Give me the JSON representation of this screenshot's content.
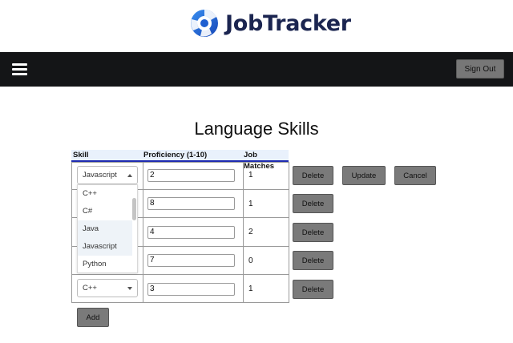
{
  "app": {
    "name": "JobTracker"
  },
  "nav": {
    "sign_out_label": "Sign Out"
  },
  "page": {
    "title": "Language Skills"
  },
  "table": {
    "headers": {
      "skill": "Skill",
      "proficiency": "Proficiency (1-10)",
      "job_matches": "Job Matches"
    },
    "rows": [
      {
        "skill": "Javascript",
        "proficiency": "2",
        "job_matches": "1"
      },
      {
        "skill": "",
        "proficiency": "8",
        "job_matches": "1"
      },
      {
        "skill": "",
        "proficiency": "4",
        "job_matches": "2"
      },
      {
        "skill": "",
        "proficiency": "7",
        "job_matches": "0"
      },
      {
        "skill": "C++",
        "proficiency": "3",
        "job_matches": "1"
      }
    ]
  },
  "buttons": {
    "delete": "Delete",
    "update": "Update",
    "cancel": "Cancel",
    "add": "Add"
  },
  "dropdown": {
    "options": [
      "C++",
      "C#",
      "Java",
      "Javascript",
      "Python"
    ],
    "highlighted": [
      "Java",
      "Javascript"
    ]
  },
  "colors": {
    "navbar": "#141517",
    "button": "#7a7a7a",
    "header_bg": "#e9f1fc",
    "header_underline": "#1e2bb0",
    "logo_text": "#1b2550",
    "logo_mark": "#1f6fd6"
  }
}
